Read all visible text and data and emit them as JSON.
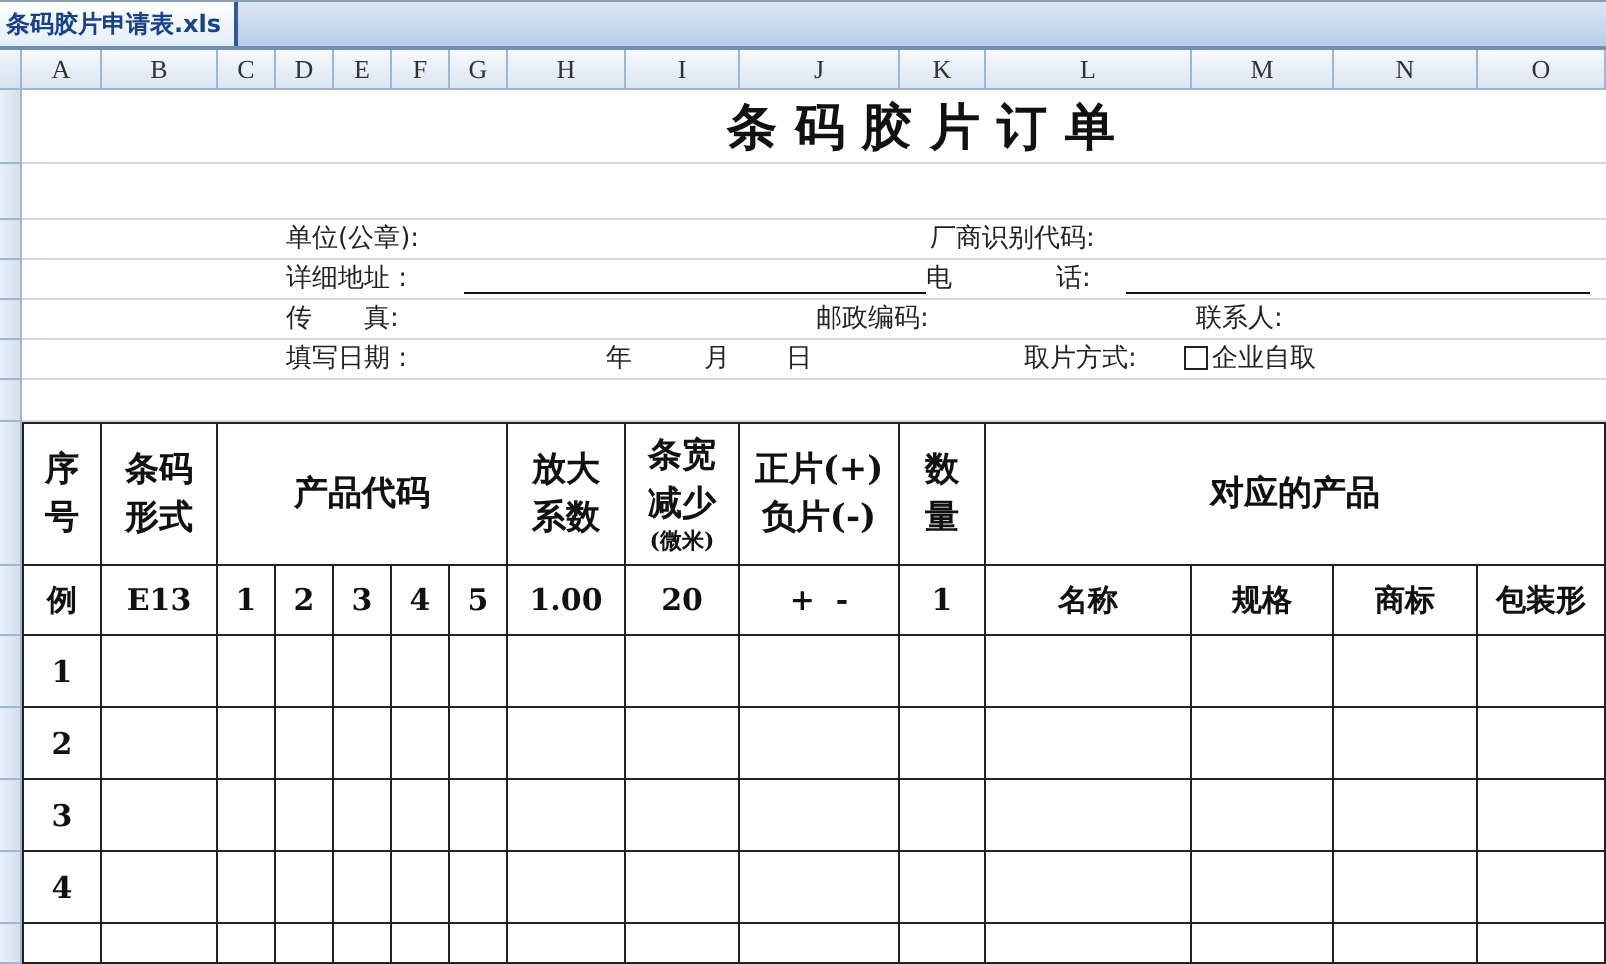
{
  "file_tab": {
    "label": "条码胶片申请表.xls",
    "selected": true
  },
  "column_headers": [
    "A",
    "B",
    "C",
    "D",
    "E",
    "F",
    "G",
    "H",
    "I",
    "J",
    "K",
    "L",
    "M",
    "N",
    "O"
  ],
  "title": "条 码 胶 片 订 单",
  "info_rows": [
    [
      {
        "kind": "text",
        "label": "单位(公章):"
      },
      {
        "kind": "text",
        "label": "厂商识别代码:"
      }
    ],
    [
      {
        "kind": "text",
        "label": "详细地址 :"
      },
      {
        "kind": "line"
      },
      {
        "kind": "text",
        "label": "电"
      },
      {
        "kind": "text",
        "label": "话:"
      },
      {
        "kind": "line"
      }
    ],
    [
      {
        "kind": "text",
        "label": "传　　真:"
      },
      {
        "kind": "text",
        "label": "邮政编码:"
      },
      {
        "kind": "text",
        "label": "联系人:"
      }
    ],
    [
      {
        "kind": "text",
        "label": "填写日期 :"
      },
      {
        "kind": "text",
        "label": "年"
      },
      {
        "kind": "text",
        "label": "月"
      },
      {
        "kind": "text",
        "label": "日"
      },
      {
        "kind": "text",
        "label": "取片方式:"
      },
      {
        "kind": "checkbox",
        "label": "企业自取",
        "checked": false
      }
    ]
  ],
  "table": {
    "header": [
      {
        "text": "序号"
      },
      {
        "text": "条码形式"
      },
      {
        "text": "产品代码"
      },
      {
        "text": "放大系数"
      },
      {
        "text": "条宽减少",
        "note": "(微米)"
      },
      {
        "text": "正片(+)负片(-)"
      },
      {
        "text": "数量"
      },
      {
        "text": "对应的产品"
      }
    ],
    "example_row": [
      "例",
      "E13",
      "1",
      "2",
      "3",
      "4",
      "5",
      "1.00",
      "20",
      "+  -",
      "1",
      "名称",
      "规格",
      "商标",
      "包装形"
    ],
    "rows": [
      {
        "number": "1"
      },
      {
        "number": "2"
      },
      {
        "number": "3"
      },
      {
        "number": "4"
      }
    ]
  }
}
